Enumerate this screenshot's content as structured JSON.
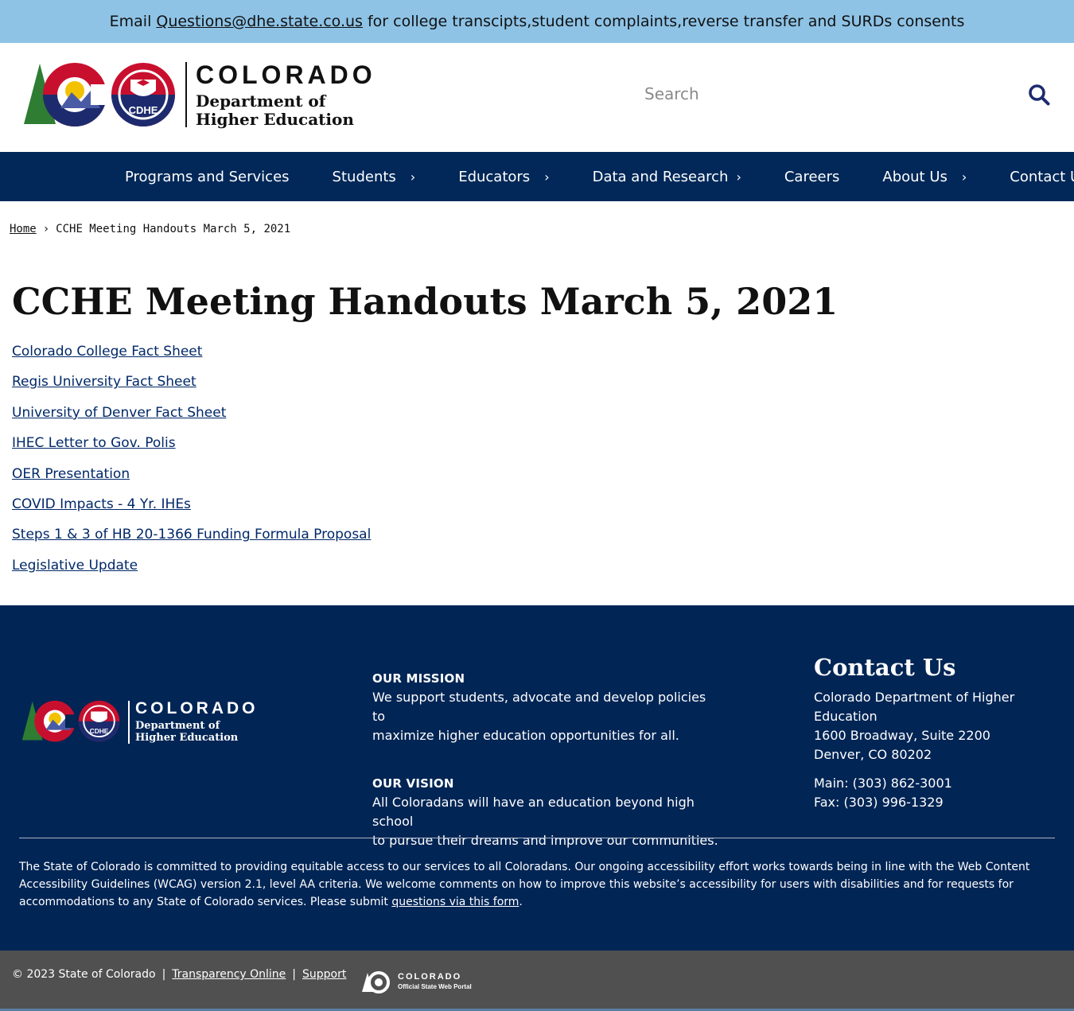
{
  "alert": {
    "prefix": "Email",
    "email": "Questions@dhe.state.co.us",
    "suffix": "for college transcipts,student complaints,reverse transfer and SURDs consents"
  },
  "header": {
    "logo_word": "COLORADO",
    "logo_sub_line1": "Department of",
    "logo_sub_line2": "Higher Education",
    "logo_badge": "CDHE",
    "search_placeholder": "Search"
  },
  "nav": {
    "items": [
      {
        "label": "Programs and Services",
        "has_submenu": false
      },
      {
        "label": "Students",
        "has_submenu": true
      },
      {
        "label": "Educators",
        "has_submenu": true
      },
      {
        "label": "Data and Research",
        "has_submenu": true
      },
      {
        "label": "Careers",
        "has_submenu": false
      },
      {
        "label": "About Us",
        "has_submenu": true
      },
      {
        "label": "Contact Us",
        "has_submenu": false
      }
    ],
    "chevron": "›"
  },
  "breadcrumb": {
    "home": "Home",
    "separator": "›",
    "current": "CCHE Meeting Handouts March 5, 2021"
  },
  "main": {
    "title": "CCHE Meeting Handouts March 5, 2021",
    "links": [
      "Colorado College Fact Sheet",
      "Regis University Fact Sheet",
      "University of Denver Fact Sheet",
      "IHEC Letter to Gov. Polis",
      "OER Presentation",
      "COVID Impacts - 4 Yr. IHEs",
      "Steps 1 & 3 of HB 20-1366 Funding Formula Proposal",
      "Legislative Update"
    ]
  },
  "footer": {
    "mission_heading": "OUR MISSION",
    "mission_line1": "We support students, advocate and develop policies to",
    "mission_line2": "maximize higher education opportunities for all.",
    "vision_heading": "OUR VISION",
    "vision_line1": "All Coloradans will have an education beyond high school",
    "vision_line2": "to pursue their dreams and improve our communities.",
    "contact_heading": "Contact Us",
    "contact_org": "Colorado Department of Higher Education",
    "contact_street": "1600 Broadway, Suite 2200",
    "contact_city": "Denver, CO 80202",
    "contact_main": "Main: (303) 862-3001",
    "contact_fax": "Fax: (303) 996-1329",
    "accessibility_text": "The State of Colorado is committed to providing equitable access to our services to all Coloradans. Our ongoing accessibility effort works towards being in line with the Web Content Accessibility Guidelines (WCAG) version 2.1, level AA criteria. We welcome comments on how to improve this website’s accessibility for users with disabilities and for requests for accommodations to any State of Colorado services. Please submit",
    "accessibility_link": "questions via this form",
    "accessibility_end": "."
  },
  "bottom": {
    "copyright": "© 2023 State of Colorado",
    "sep": "|",
    "transparency": "Transparency Online",
    "support": "Support",
    "portal_word": "COLORADO",
    "portal_sub": "Official State Web Portal"
  },
  "colors": {
    "banner": "#8ec3e6",
    "nav": "#012859",
    "footer": "#012555",
    "bottom_bar": "#505050",
    "link": "#002868"
  }
}
